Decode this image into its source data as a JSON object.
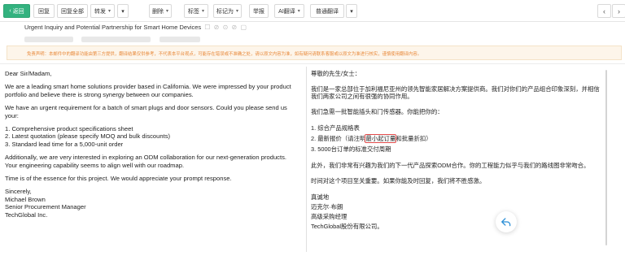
{
  "toolbar": {
    "back": "返回",
    "reply": "回复",
    "reply_all": "回复全部",
    "forward": "转发",
    "delete": "删除",
    "mark": "标签",
    "mark_as": "标记为",
    "report": "举报",
    "ai_translate": "AI翻译",
    "standard_translate": "普通翻译"
  },
  "email": {
    "subject": "Urgent Inquiry and Potential Partnership for Smart Home Devices",
    "subject_icons": "☐ ⊘ ⊙ ⊘ ▢"
  },
  "disclaimer": "免责声明：本邮件中的翻译功能由第三方提供，翻译结果仅供参考，不代表本平台观点，可能存在错误或不准确之处，请以原文内容为准，如有疑问请联系客服或以原文为准进行核实，谨慎使用翻译内容。",
  "original": {
    "greeting": "Dear Sir/Madam,",
    "p1": "We are a leading smart home solutions provider based in California. We were impressed by your product portfolio and believe there is strong synergy between our companies.",
    "p2": "We have an urgent requirement for a batch of smart plugs and door sensors. Could you please send us your:",
    "list": [
      "1. Comprehensive product specifications sheet",
      "2. Latest quotation (please specify MOQ and bulk discounts)",
      "3. Standard lead time for a 5,000-unit order"
    ],
    "p3": "Additionally, we are very interested in exploring an ODM collaboration for our next-generation products. Your engineering capability seems to align well with our roadmap.",
    "p4": "Time is of the essence for this project. We would appreciate your prompt response.",
    "sign": [
      "Sincerely,",
      "Michael Brown",
      "Senior Procurement Manager",
      "TechGlobal Inc."
    ]
  },
  "translation": {
    "greeting": "尊敬的先生/女士：",
    "p1": "我们是一家总部位于加利福尼亚州的领先智能家居解决方案提供商。我们对你们的产品组合印象深刻，并相信我们两家公司之间有很强的协同作用。",
    "p2": "我们急需一批智能插头和门传感器。你能把你的：",
    "item1": "1. 综合产品规格表",
    "item2_pre": "2. 最新报价（请注明",
    "item2_hl": "最小起订量",
    "item2_post": "和批量折扣）",
    "item3": "3. 5000台订单的标准交付周期",
    "p3": "此外，我们非常有兴趣为我们的下一代产品探索ODM合作。你的工程能力似乎与我们的路线图非常吻合。",
    "p4": "时间对这个项目至关重要。如果你能及时回复，我们将不胜感激。",
    "sign": [
      "真诚地",
      "迈克尔·布朗",
      "高级采购经理",
      "TechGlobal股份有限公司。"
    ]
  },
  "colors": {
    "accent": "#33b27f",
    "warning": "#e8893a",
    "highlight": "#e24b4b"
  }
}
